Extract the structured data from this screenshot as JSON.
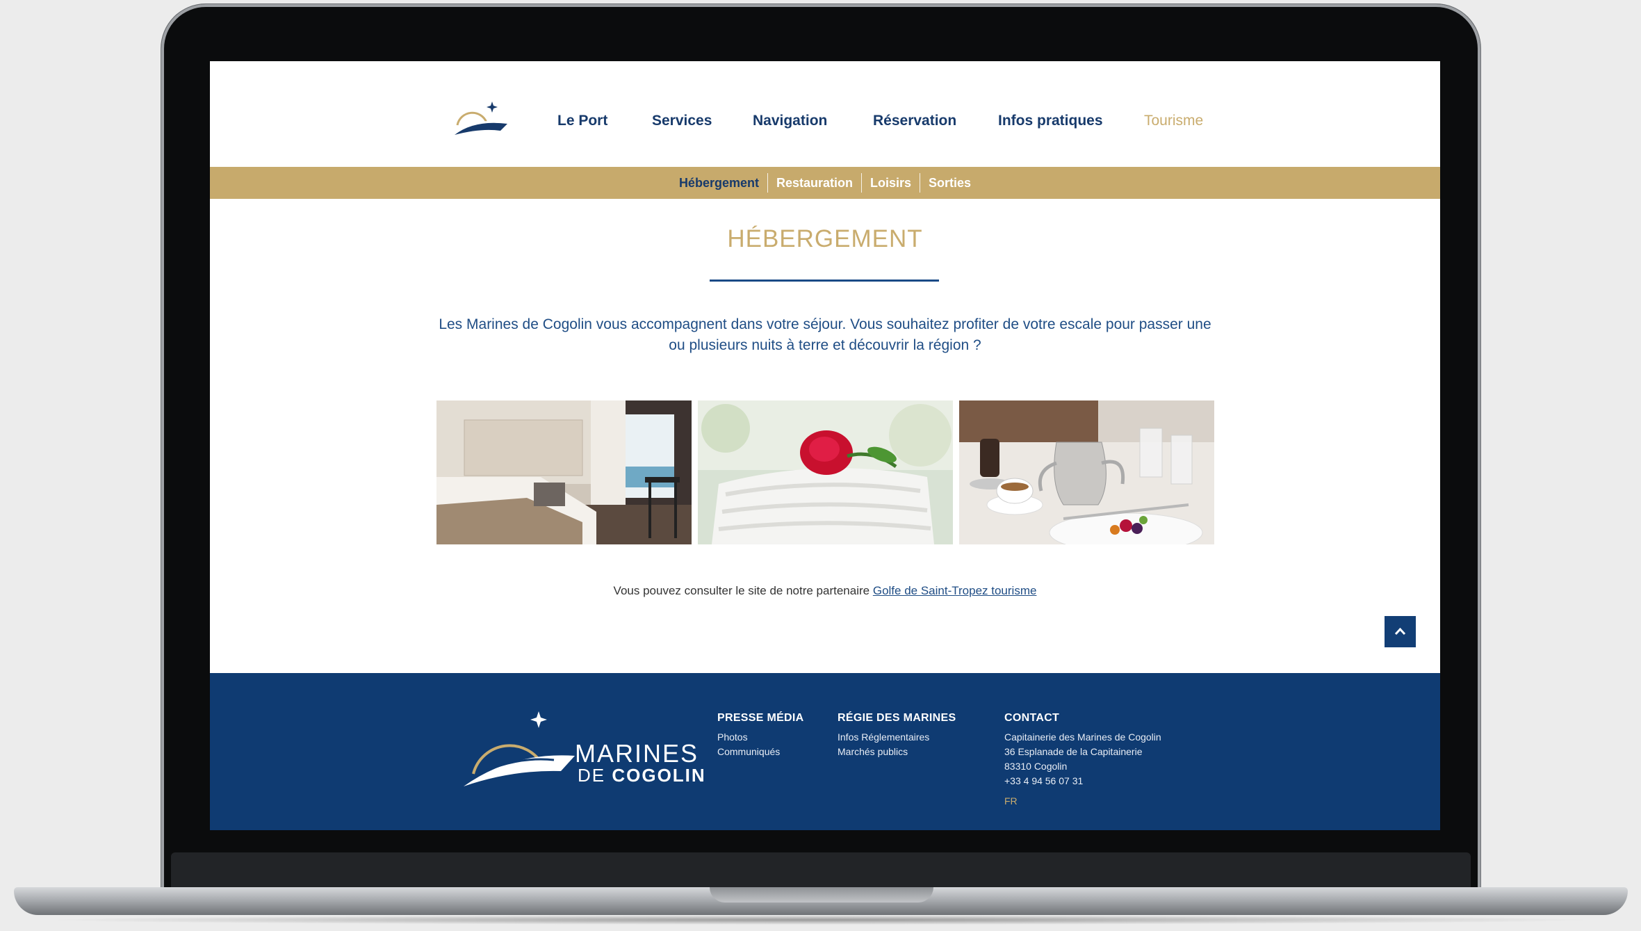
{
  "nav": {
    "items": [
      {
        "label": "Le Port"
      },
      {
        "label": "Services"
      },
      {
        "label": "Navigation"
      },
      {
        "label": "Réservation"
      },
      {
        "label": "Infos pratiques"
      },
      {
        "label": "Tourisme"
      }
    ]
  },
  "subnav": {
    "items": [
      {
        "label": "Hébergement"
      },
      {
        "label": "Restauration"
      },
      {
        "label": "Loisirs"
      },
      {
        "label": "Sorties"
      }
    ]
  },
  "page": {
    "title": "HÉBERGEMENT",
    "intro": "Les Marines de Cogolin vous accompagnent dans votre séjour. Vous souhaitez profiter de votre escale pour passer une ou plusieurs nuits à terre et découvrir la région ?",
    "partner_text": "Vous pouvez consulter le site de notre partenaire ",
    "partner_link": "Golfe de Saint-Tropez tourisme"
  },
  "footer": {
    "brand_line1": "MARINES",
    "brand_de": "DE ",
    "brand_line2": "COGOLIN",
    "press": {
      "heading": "PRESSE MÉDIA",
      "links": [
        "Photos",
        "Communiqués"
      ]
    },
    "regie": {
      "heading": "RÉGIE DES MARINES",
      "links": [
        "Infos Réglementaires",
        "Marchés publics"
      ]
    },
    "contact": {
      "heading": "CONTACT",
      "lines": [
        "Capitainerie des Marines de Cogolin",
        "36 Esplanade de la Capitainerie",
        "83310 Cogolin",
        "+33 4 94 56 07 31"
      ],
      "language": "FR"
    }
  },
  "colors": {
    "navy": "#0f3b72",
    "gold": "#c7aa6c",
    "title_gold": "#c9ac6e"
  },
  "icons": [
    "marines-logo-icon",
    "chevron-up-icon"
  ]
}
